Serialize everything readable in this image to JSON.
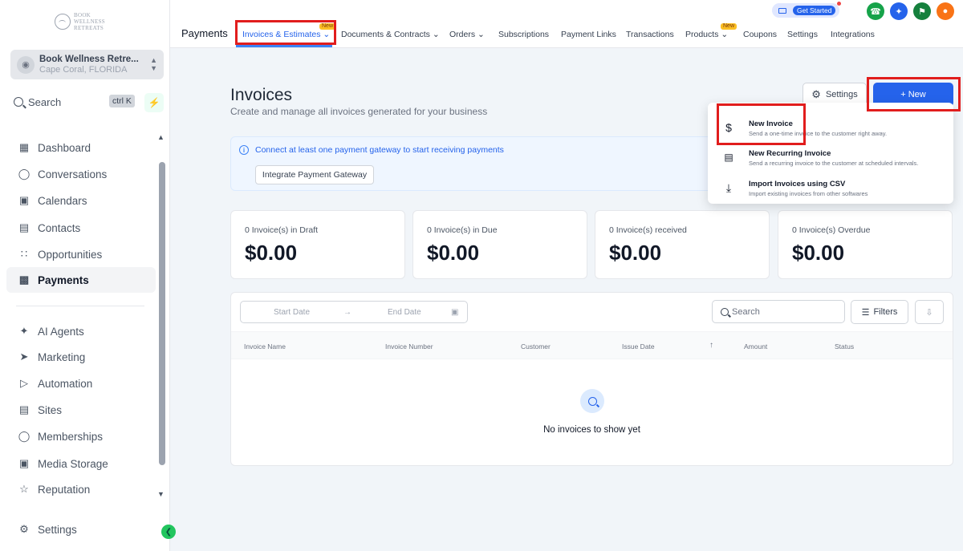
{
  "sidebar": {
    "logo_text": "BOOK WELLNESS RETREATS",
    "location": {
      "name": "Book Wellness Retre...",
      "address": "Cape Coral, FLORIDA"
    },
    "search": {
      "label": "Search",
      "shortcut": "ctrl K"
    },
    "items": [
      {
        "label": "Dashboard",
        "icon": "dashboard-icon"
      },
      {
        "label": "Conversations",
        "icon": "chat-icon"
      },
      {
        "label": "Calendars",
        "icon": "calendar-icon"
      },
      {
        "label": "Contacts",
        "icon": "contacts-icon"
      },
      {
        "label": "Opportunities",
        "icon": "opportunities-icon"
      },
      {
        "label": "Payments",
        "icon": "payments-icon",
        "active": true
      },
      {
        "label": "AI Agents",
        "icon": "sparkle-icon"
      },
      {
        "label": "Marketing",
        "icon": "send-icon"
      },
      {
        "label": "Automation",
        "icon": "automation-icon"
      },
      {
        "label": "Sites",
        "icon": "sites-icon"
      },
      {
        "label": "Memberships",
        "icon": "membership-icon"
      },
      {
        "label": "Media Storage",
        "icon": "image-icon"
      },
      {
        "label": "Reputation",
        "icon": "star-icon"
      },
      {
        "label": "Settings",
        "icon": "gear-icon"
      }
    ]
  },
  "topbar": {
    "section": "Payments",
    "tabs": [
      {
        "label": "Invoices & Estimates",
        "dropdown": true,
        "badge": "New",
        "active": true
      },
      {
        "label": "Documents & Contracts",
        "dropdown": true
      },
      {
        "label": "Orders",
        "dropdown": true
      },
      {
        "label": "Subscriptions"
      },
      {
        "label": "Payment Links"
      },
      {
        "label": "Transactions"
      },
      {
        "label": "Products",
        "dropdown": true,
        "badge": "New"
      },
      {
        "label": "Coupons"
      },
      {
        "label": "Settings"
      },
      {
        "label": "Integrations"
      }
    ],
    "get_started": "Get Started"
  },
  "page": {
    "title": "Invoices",
    "subtitle": "Create and manage all invoices generated for your business",
    "settings_button": "Settings",
    "new_button": "+ New"
  },
  "banner": {
    "message": "Connect at least one payment gateway to start receiving payments",
    "button": "Integrate Payment Gateway"
  },
  "stats": [
    {
      "label": "0 Invoice(s) in Draft",
      "value": "$0.00"
    },
    {
      "label": "0 Invoice(s) in Due",
      "value": "$0.00"
    },
    {
      "label": "0 Invoice(s) received",
      "value": "$0.00"
    },
    {
      "label": "0 Invoice(s) Overdue",
      "value": "$0.00"
    }
  ],
  "table": {
    "start_date": "Start Date",
    "end_date": "End Date",
    "search_placeholder": "Search",
    "filters": "Filters",
    "columns": [
      "Invoice Name",
      "Invoice Number",
      "Customer",
      "Issue Date",
      "Amount",
      "Status"
    ],
    "empty": "No invoices to show yet"
  },
  "dropdown": {
    "items": [
      {
        "title": "New Invoice",
        "desc": "Send a one-time invoice to the customer right away.",
        "icon": "dollar-icon"
      },
      {
        "title": "New Recurring Invoice",
        "desc": "Send a recurring invoice to the customer at scheduled intervals.",
        "icon": "recurring-icon"
      },
      {
        "title": "Import Invoices using CSV",
        "desc": "Import existing invoices from other softwares",
        "icon": "download-icon"
      }
    ]
  },
  "colors": {
    "accent": "#2563eb",
    "highlight": "#e11d1d",
    "badge": "#fbbf24"
  }
}
